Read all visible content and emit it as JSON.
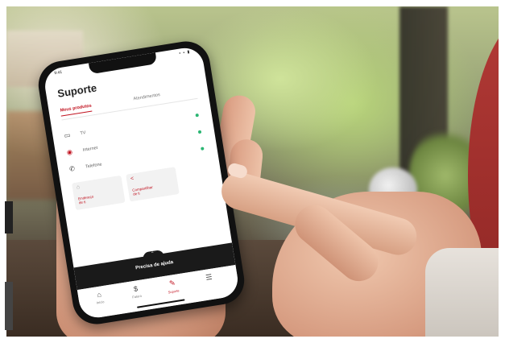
{
  "phone_app": {
    "status": {
      "time": "9:41",
      "icons": "▪ ▪ ▮"
    },
    "title": "Suporte",
    "tabs": [
      {
        "label": "Meus produtos",
        "active": true
      },
      {
        "label": "Atendimentos",
        "active": false
      }
    ],
    "products": [
      {
        "label": "TV",
        "icon": "tv-icon",
        "status_color": "#2bb673"
      },
      {
        "label": "Internet",
        "icon": "wifi-icon",
        "status_color": "#2bb673"
      },
      {
        "label": "Telefone",
        "icon": "phone-icon",
        "status_color": "#2bb673"
      }
    ],
    "cards": [
      {
        "label_line1": "Endereço",
        "label_line2": "de ti",
        "icon": "home-icon"
      },
      {
        "label_line1": "Compartilhar",
        "label_line2": "de ti",
        "icon": "share-icon"
      }
    ],
    "help_bar_label": "Precisa de ajuda",
    "help_handle": "⌃",
    "nav": [
      {
        "label": "Início",
        "glyph": "⌂",
        "icon": "home-icon",
        "active": false
      },
      {
        "label": "Fatura",
        "glyph": "$",
        "icon": "dollar-icon",
        "active": false
      },
      {
        "label": "Suporte",
        "glyph": "✎",
        "icon": "wrench-icon",
        "active": true
      },
      {
        "label": "",
        "glyph": "☰",
        "icon": "menu-icon",
        "active": false
      }
    ],
    "accent_color": "#c1121f"
  }
}
